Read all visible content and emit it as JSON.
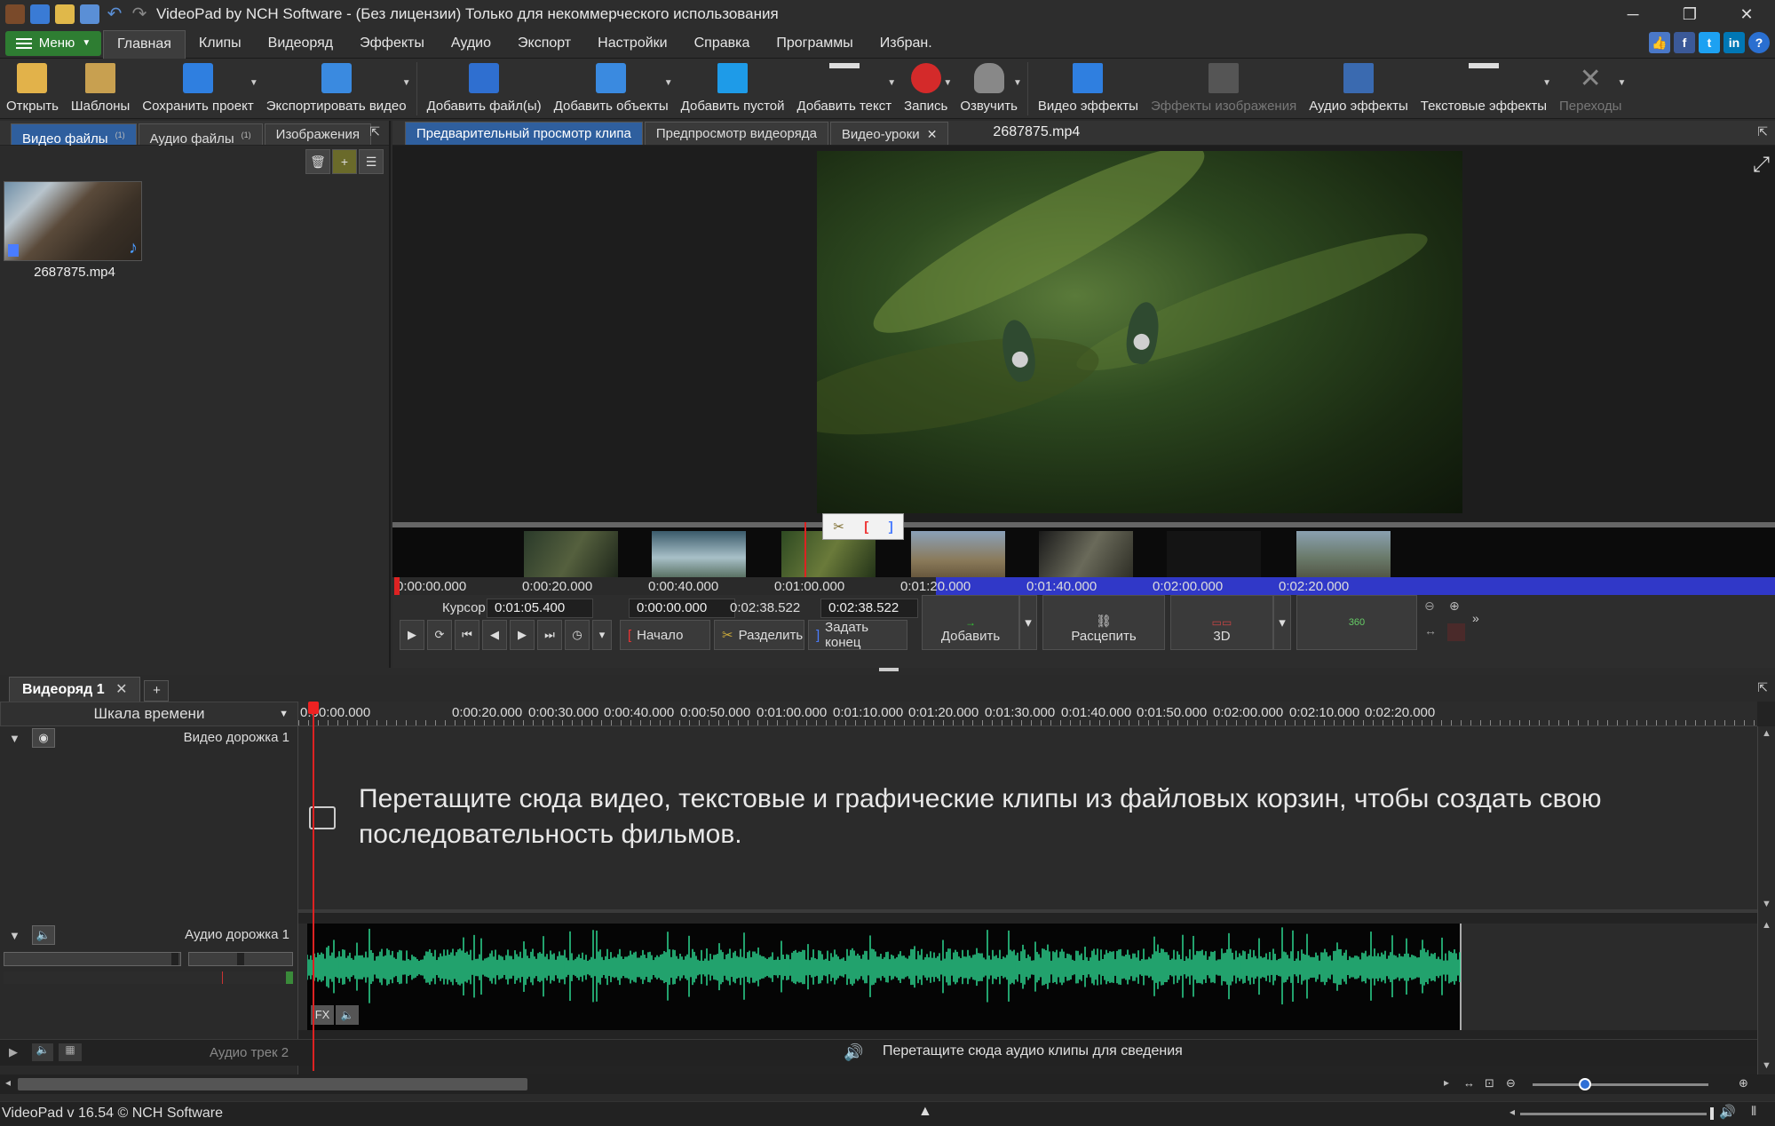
{
  "window": {
    "title": "VideoPad by NCH Software - (Без лицензии) Только для некоммерческого использования",
    "minimize": "─",
    "restore": "❐",
    "close": "✕"
  },
  "menubar": {
    "menu_button": "Меню",
    "tabs": [
      "Главная",
      "Клипы",
      "Видеоряд",
      "Эффекты",
      "Аудио",
      "Экспорт",
      "Настройки",
      "Справка",
      "Программы",
      "Избран."
    ],
    "active_tab": "Главная",
    "social": [
      "f",
      "t",
      "in",
      "?"
    ]
  },
  "toolbar": {
    "items": [
      {
        "label": "Открыть",
        "icon": "open-folder-icon"
      },
      {
        "label": "Шаблоны",
        "icon": "templates-icon"
      },
      {
        "label": "Сохранить проект",
        "icon": "save-icon"
      },
      {
        "label": "Экспортировать видео",
        "icon": "export-video-icon"
      },
      {
        "label": "Добавить файл(ы)",
        "icon": "add-files-icon"
      },
      {
        "label": "Добавить объекты",
        "icon": "add-objects-icon"
      },
      {
        "label": "Добавить пустой",
        "icon": "add-blank-icon"
      },
      {
        "label": "Добавить текст",
        "icon": "add-text-icon"
      },
      {
        "label": "Запись",
        "icon": "record-icon"
      },
      {
        "label": "Озвучить",
        "icon": "narrate-mic-icon"
      },
      {
        "label": "Видео эффекты",
        "icon": "video-effects-icon"
      },
      {
        "label": "Эффекты изображения",
        "icon": "image-effects-icon"
      },
      {
        "label": "Аудио эффекты",
        "icon": "audio-effects-icon"
      },
      {
        "label": "Текстовые эффекты",
        "icon": "text-effects-icon"
      },
      {
        "label": "Переходы",
        "icon": "transitions-icon"
      }
    ]
  },
  "bin": {
    "tabs": [
      {
        "label": "Видео файлы",
        "count": "(1)"
      },
      {
        "label": "Аудио файлы",
        "count": "(1)"
      },
      {
        "label": "Изображения",
        "count": ""
      }
    ],
    "file": {
      "name": "2687875.mp4"
    }
  },
  "preview": {
    "tabs": [
      {
        "label": "Предварительный просмотр клипа"
      },
      {
        "label": "Предпросмотр видеоряда"
      },
      {
        "label": "Видео-уроки",
        "close": "✕"
      }
    ],
    "clip_name": "2687875.mp4",
    "ruler_ticks": [
      "0:00:00.000",
      "0:00:20.000",
      "0:00:40.000",
      "0:01:00.000",
      "0:01:20.000",
      "0:01:40.000",
      "0:02:00.000",
      "0:02:20.000"
    ],
    "cursor_label": "Курсор:",
    "cursor_value": "0:01:05.400",
    "in_value": "0:00:00.000",
    "duration_value": "0:02:38.522",
    "out_value": "0:02:38.522",
    "mark_in_label": "Начало",
    "split_label": "Разделить",
    "mark_out_label": "Задать конец",
    "add_label": "Добавить",
    "unlink_label": "Расцепить",
    "threed_label": "3D",
    "threesixty_label": "360"
  },
  "sequence": {
    "tab": "Видеоряд 1",
    "timeline_mode": "Шкала времени",
    "ruler_ticks": [
      "0:00:00.000",
      "0:00:20.000",
      "0:00:30.000",
      "0:00:40.000",
      "0:00:50.000",
      "0:01:00.000",
      "0:01:10.000",
      "0:01:20.000",
      "0:01:30.000",
      "0:01:40.000",
      "0:01:50.000",
      "0:02:00.000",
      "0:02:10.000",
      "0:02:20.000"
    ],
    "video_track": "Видео дорожка 1",
    "audio_track": "Аудио дорожка 1",
    "audio_track2": "Аудио трек 2",
    "video_drop_hint": "Перетащите сюда видео, текстовые и графические клипы из файловых корзин, чтобы создать свою последовательность фильмов.",
    "audio_drop_hint": "Перетащите сюда аудио клипы для сведения",
    "fx_label": "FX"
  },
  "status": {
    "text": "VideoPad v 16.54 © NCH Software"
  },
  "colors": {
    "accent_blue": "#2f5f9e",
    "selection_blue": "#3038c8",
    "menu_green": "#2e7d32",
    "waveform_green": "#2ee59a",
    "playhead_red": "#dd2222"
  }
}
